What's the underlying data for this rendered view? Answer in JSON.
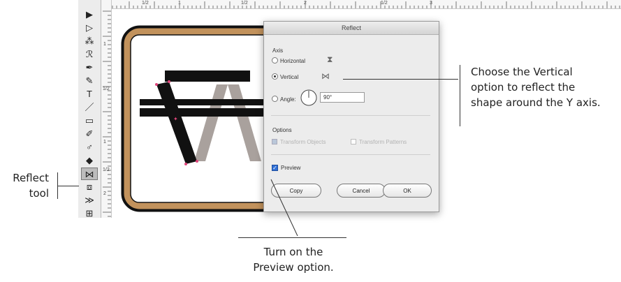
{
  "toolbar": {
    "tools": [
      {
        "name": "selection-tool-icon",
        "glyph": "▶"
      },
      {
        "name": "direct-selection-tool-icon",
        "glyph": "▷"
      },
      {
        "name": "magic-wand-tool-icon",
        "glyph": "⁂"
      },
      {
        "name": "lasso-tool-icon",
        "glyph": "ℛ"
      },
      {
        "name": "pen-tool-icon",
        "glyph": "✒"
      },
      {
        "name": "curvature-tool-icon",
        "glyph": "✎"
      },
      {
        "name": "type-tool-icon",
        "glyph": "T"
      },
      {
        "name": "line-tool-icon",
        "glyph": "／"
      },
      {
        "name": "rectangle-tool-icon",
        "glyph": "▭"
      },
      {
        "name": "paintbrush-tool-icon",
        "glyph": "✐"
      },
      {
        "name": "shaper-tool-icon",
        "glyph": "♂"
      },
      {
        "name": "eraser-tool-icon",
        "glyph": "◆"
      },
      {
        "name": "reflect-tool-icon",
        "glyph": "⋈"
      },
      {
        "name": "scale-tool-icon",
        "glyph": "⧈"
      },
      {
        "name": "width-tool-icon",
        "glyph": "≫"
      },
      {
        "name": "free-transform-tool-icon",
        "glyph": "⊞"
      }
    ]
  },
  "ruler": {
    "labels": [
      "1/2",
      "1",
      "1/2",
      "2",
      "1/2",
      "3"
    ],
    "vlabels": [
      "1",
      "1/2",
      "1",
      "1/2",
      "2"
    ]
  },
  "dialog": {
    "title": "Reflect",
    "axis_label": "Axis",
    "horizontal_label": "Horizontal",
    "vertical_label": "Vertical",
    "angle_label": "Angle:",
    "angle_value": "90°",
    "options_label": "Options",
    "transform_objects_label": "Transform Objects",
    "transform_patterns_label": "Transform Patterns",
    "preview_label": "Preview",
    "copy_label": "Copy",
    "cancel_label": "Cancel",
    "ok_label": "OK",
    "selected_axis": "vertical",
    "preview_checked": true
  },
  "callouts": {
    "vertical": [
      "Choose the Vertical",
      "option to reflect the",
      "shape around the Y axis."
    ],
    "reflect_tool": [
      "Reflect",
      "tool"
    ],
    "preview": [
      "Turn on the",
      "Preview option."
    ]
  },
  "colors": {
    "frame_brown": "#c2925c",
    "table_black": "#111111",
    "reflection_gray": "#a9a19d",
    "anchor_magenta": "#e0457b",
    "checkbox_blue": "#2f6fd6"
  }
}
